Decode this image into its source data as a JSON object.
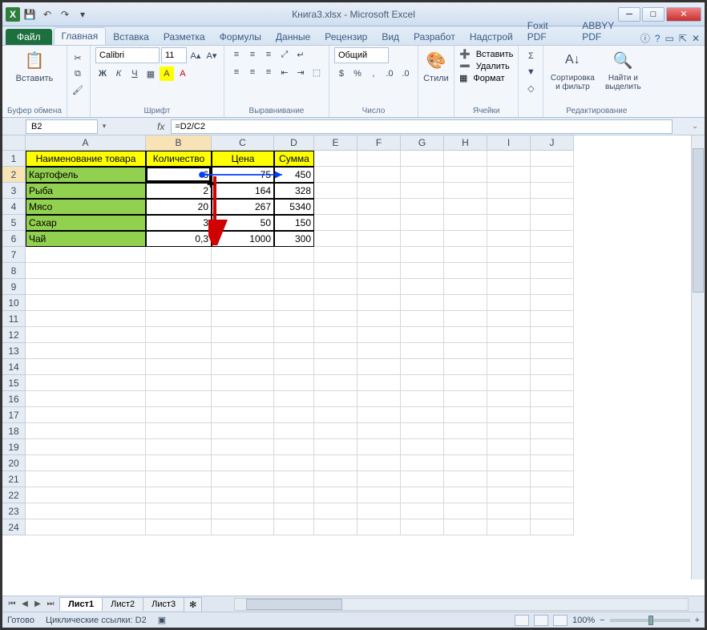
{
  "app_title": "Книга3.xlsx - Microsoft Excel",
  "tabs": {
    "file": "Файл",
    "items": [
      "Главная",
      "Вставка",
      "Разметка",
      "Формулы",
      "Данные",
      "Рецензир",
      "Вид",
      "Разработ",
      "Надстрой",
      "Foxit PDF",
      "ABBYY PDF"
    ],
    "active": "Главная"
  },
  "ribbon": {
    "clipboard": {
      "paste": "Вставить",
      "title": "Буфер обмена"
    },
    "font": {
      "name": "Calibri",
      "size": "11",
      "title": "Шрифт",
      "bold": "Ж",
      "italic": "К",
      "underline": "Ч"
    },
    "align": {
      "title": "Выравнивание"
    },
    "number": {
      "format": "Общий",
      "title": "Число",
      "percent": "%"
    },
    "styles": {
      "label": "Стили"
    },
    "cells": {
      "insert": "Вставить",
      "delete": "Удалить",
      "format": "Формат",
      "title": "Ячейки"
    },
    "editing": {
      "sort": "Сортировка и фильтр",
      "find": "Найти и выделить",
      "title": "Редактирование"
    }
  },
  "namebox": "B2",
  "formula": "=D2/C2",
  "columns": [
    {
      "l": "A",
      "w": 150
    },
    {
      "l": "B",
      "w": 82
    },
    {
      "l": "C",
      "w": 78
    },
    {
      "l": "D",
      "w": 50
    },
    {
      "l": "E",
      "w": 54
    },
    {
      "l": "F",
      "w": 54
    },
    {
      "l": "G",
      "w": 54
    },
    {
      "l": "H",
      "w": 54
    },
    {
      "l": "I",
      "w": 54
    },
    {
      "l": "J",
      "w": 54
    }
  ],
  "row_count": 24,
  "headers": {
    "A": "Наименование товара",
    "B": "Количество",
    "C": "Цена",
    "D": "Сумма"
  },
  "rows": [
    {
      "A": "Картофель",
      "B": "6",
      "C": "75",
      "D": "450"
    },
    {
      "A": "Рыба",
      "B": "2",
      "C": "164",
      "D": "328"
    },
    {
      "A": "Мясо",
      "B": "20",
      "C": "267",
      "D": "5340"
    },
    {
      "A": "Сахар",
      "B": "3",
      "C": "50",
      "D": "150"
    },
    {
      "A": "Чай",
      "B": "0,3",
      "C": "1000",
      "D": "300"
    }
  ],
  "sheets": [
    "Лист1",
    "Лист2",
    "Лист3"
  ],
  "active_sheet": "Лист1",
  "status": {
    "ready": "Готово",
    "circular": "Циклические ссылки: D2",
    "zoom": "100%"
  }
}
